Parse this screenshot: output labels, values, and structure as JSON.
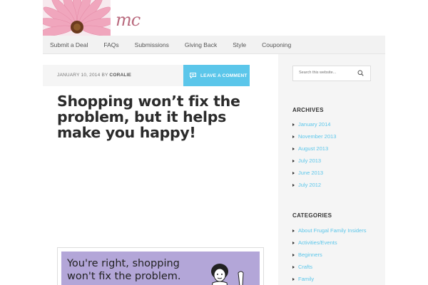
{
  "site": {
    "logo_text": "mc"
  },
  "nav": {
    "items": [
      "Submit a Deal",
      "FAQs",
      "Submissions",
      "Giving Back",
      "Style",
      "Couponing"
    ]
  },
  "post": {
    "date": "JANUARY 10, 2014",
    "by": "BY",
    "author": "CORALIE",
    "comment_label": "LEAVE A COMMENT",
    "title": "Shopping won’t fix the problem, but it helps make you happy!",
    "image_text_line1": "You're right, shopping",
    "image_text_line2": "won't fix the problem."
  },
  "sidebar": {
    "search_placeholder": "Search this website...",
    "archives_title": "ARCHIVES",
    "archives": [
      "January 2014",
      "November 2013",
      "August 2013",
      "July 2013",
      "June 2013",
      "July 2012"
    ],
    "categories_title": "CATEGORIES",
    "categories": [
      "About Frugal Family Insiders",
      "Activities/Events",
      "Beginners",
      "Crafts",
      "Family"
    ]
  },
  "colors": {
    "accent": "#5bc6ea",
    "logo": "#b96a7e",
    "ecard_bg": "#b3a6d8"
  }
}
